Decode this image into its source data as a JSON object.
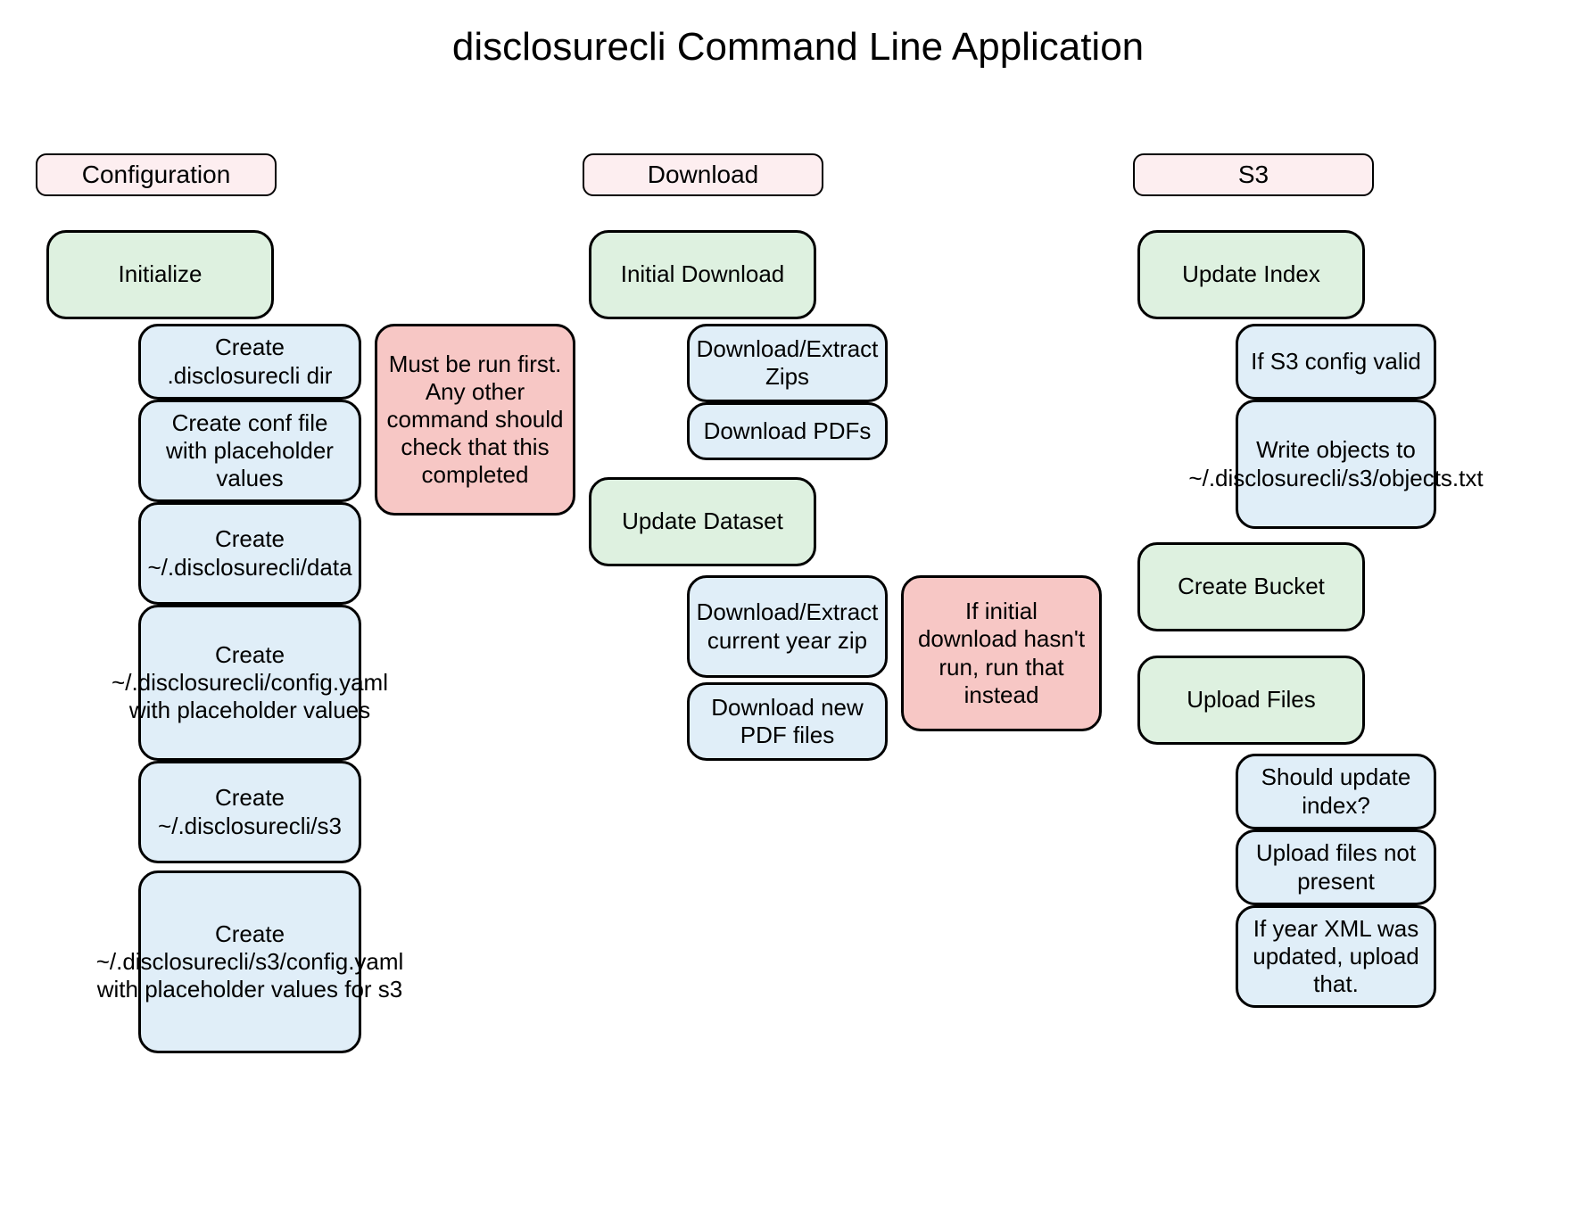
{
  "title": "disclosurecli Command Line Application",
  "colors": {
    "section_header_bg": "#fdeef0",
    "action_bg": "#def1e0",
    "step_bg": "#e0eef8",
    "note_bg": "#f7c7c5",
    "border": "#000000"
  },
  "sections": {
    "configuration": {
      "label": "Configuration"
    },
    "download": {
      "label": "Download"
    },
    "s3": {
      "label": "S3"
    }
  },
  "config": {
    "initialize": "Initialize",
    "steps": [
      "Create .disclosurecli dir",
      "Create conf file with placeholder values",
      "Create ~/.disclosurecli/data",
      "Create ~/.disclosurecli/config.yaml with placeholder values",
      "Create ~/.disclosurecli/s3",
      "Create ~/.disclosurecli/s3/config.yaml with placeholder values for s3"
    ],
    "note": "Must be run first. Any other command should check that this completed"
  },
  "download": {
    "initial": "Initial Download",
    "initial_steps": [
      "Download/Extract Zips",
      "Download PDFs"
    ],
    "update": "Update Dataset",
    "update_steps": [
      "Download/Extract current year zip",
      "Download new PDF files"
    ],
    "note": "If initial download hasn't run, run that instead"
  },
  "s3": {
    "update_index": "Update Index",
    "index_steps": [
      "If S3 config valid",
      "Write objects to ~/.disclosurecli/s3/objects.txt"
    ],
    "create_bucket": "Create Bucket",
    "upload_files": "Upload Files",
    "upload_steps": [
      "Should update index?",
      "Upload files not present",
      "If year XML was updated, upload that."
    ]
  }
}
